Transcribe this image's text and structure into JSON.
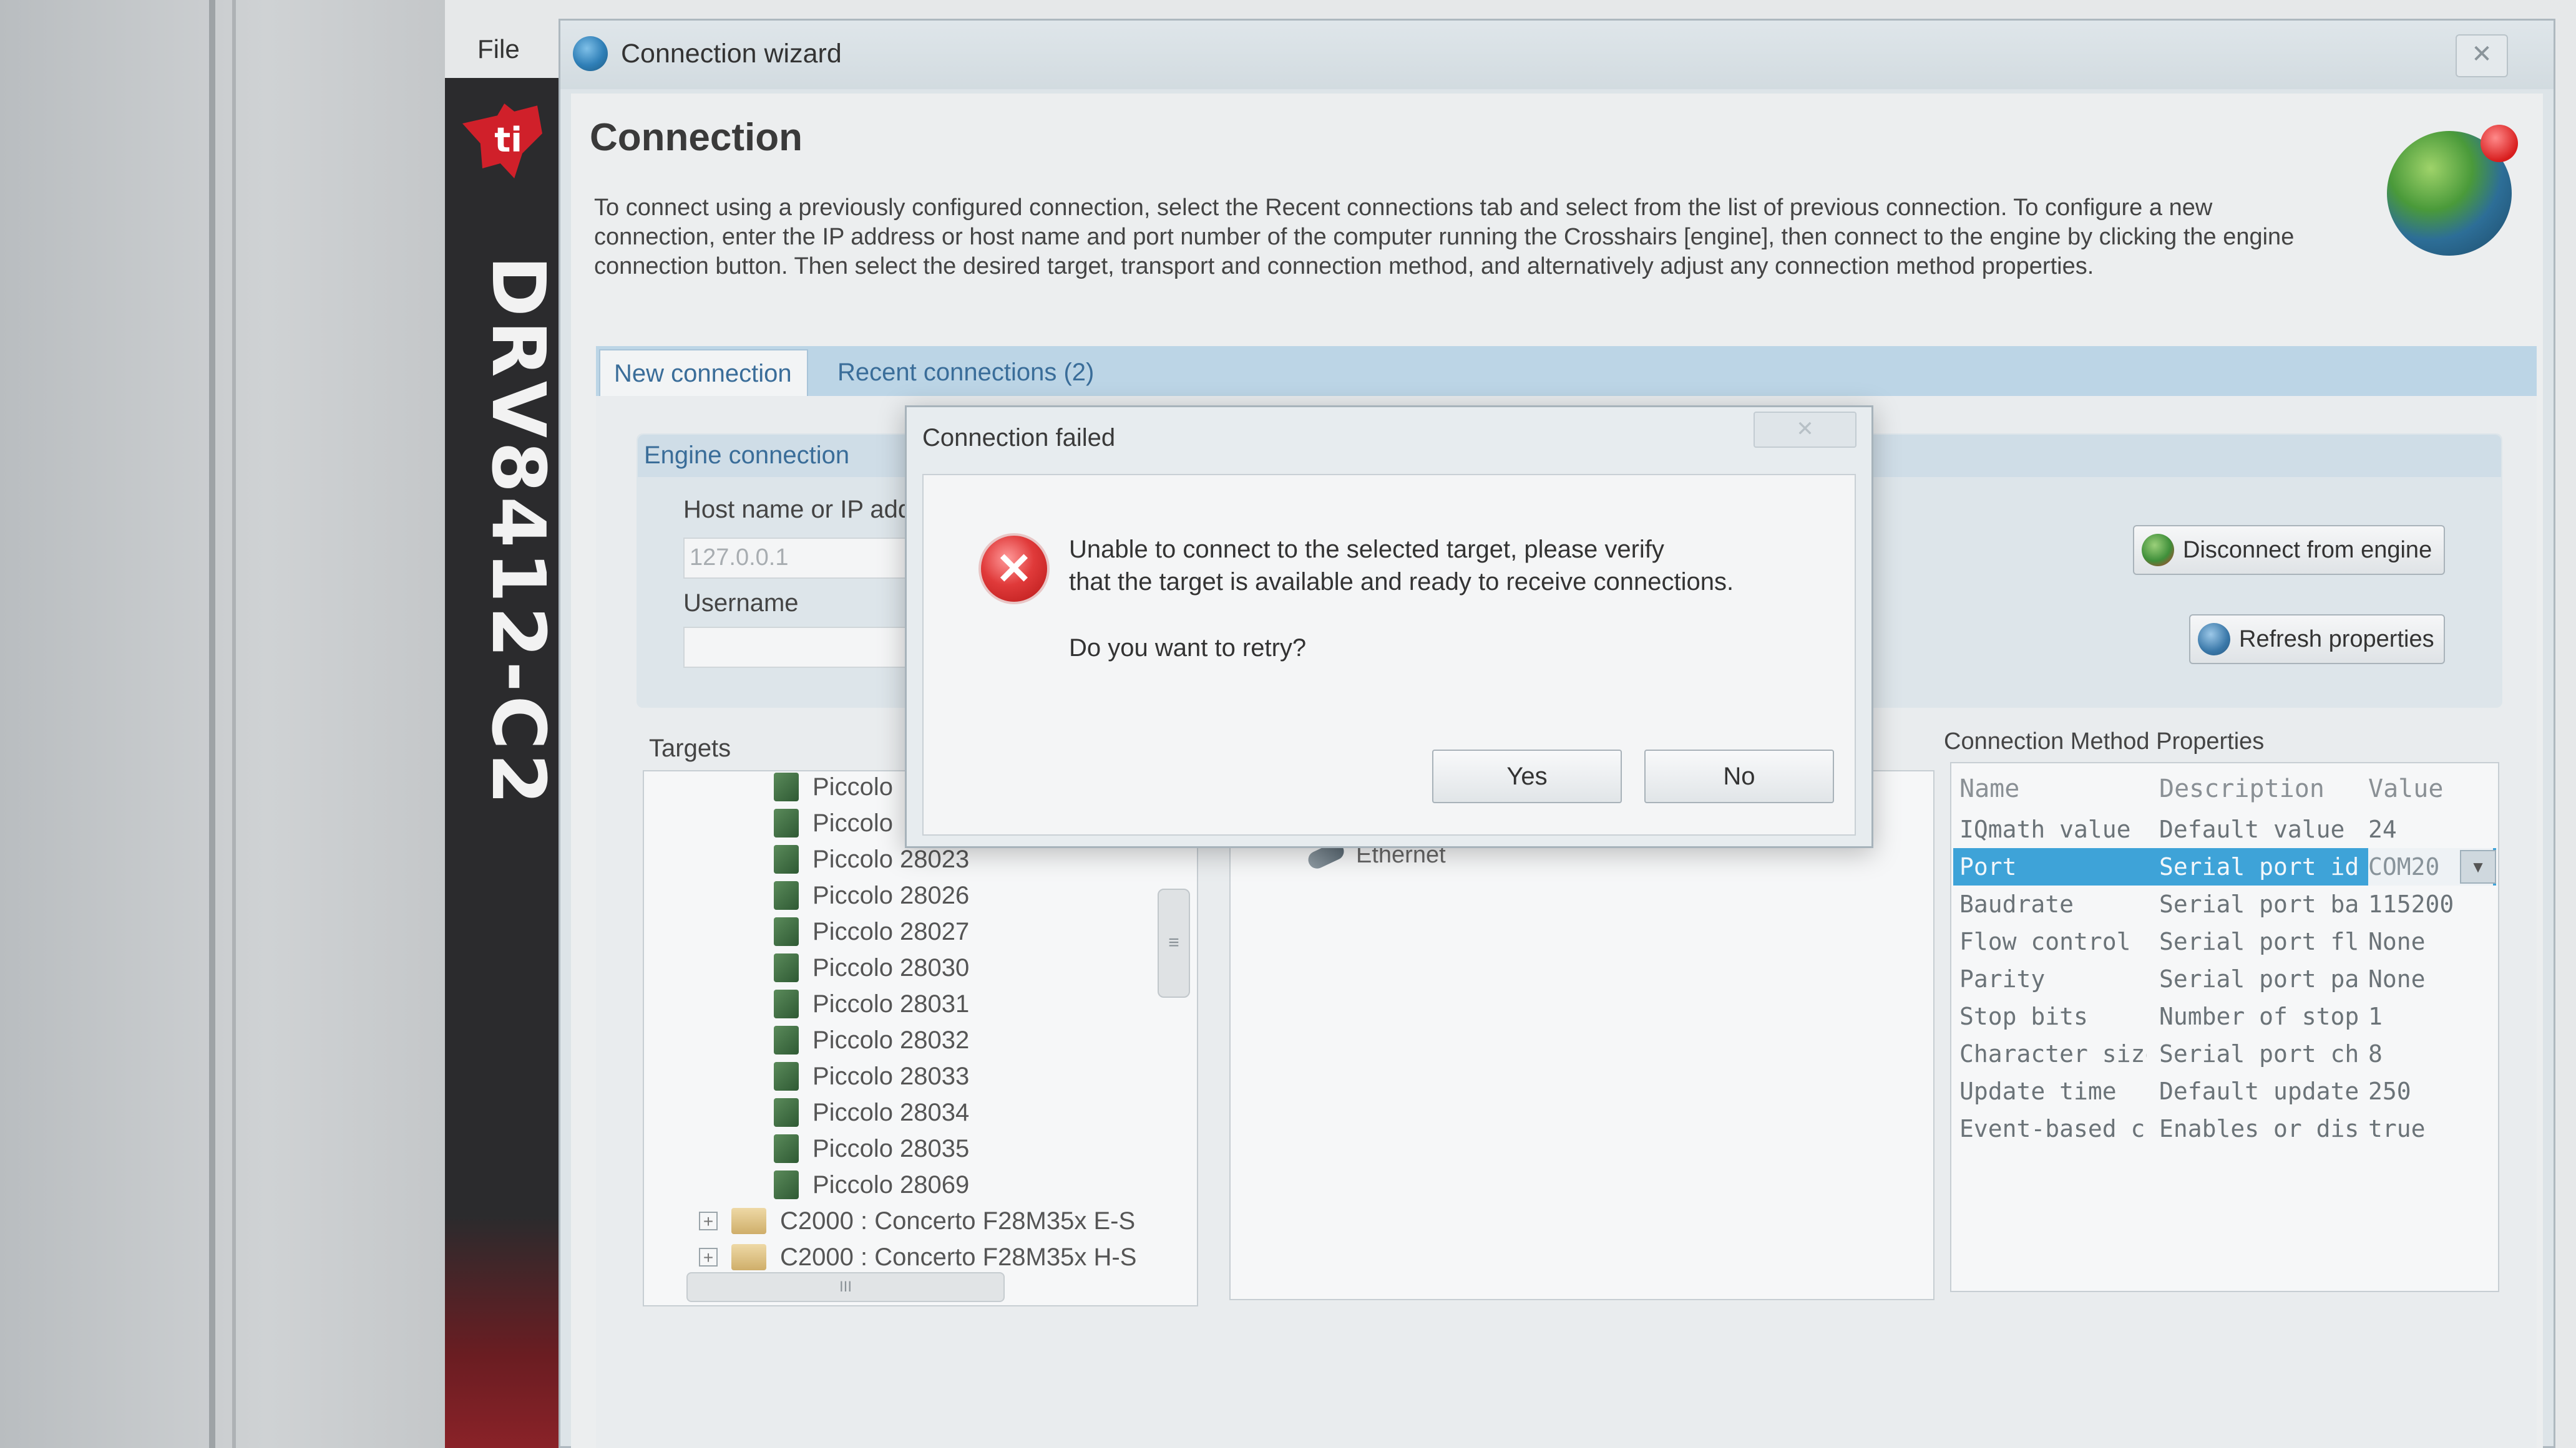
{
  "menu": {
    "file": "File"
  },
  "banner": {
    "product": "DRV8412-C2"
  },
  "wizard": {
    "title": "Connection wizard",
    "heading": "Connection",
    "description": "To connect using a previously configured connection, select the Recent connections tab and select from the list of previous connection. To configure a new connection, enter the IP address or host name and port number of the computer running the Crosshairs [engine], then connect to the engine by clicking the engine connection button. Then select the desired target, transport and connection method, and alternatively adjust any connection method properties.",
    "tabs": [
      {
        "label": "New connection",
        "active": true
      },
      {
        "label": "Recent connections (2)",
        "active": false
      }
    ]
  },
  "engine": {
    "title": "Engine connection",
    "host_label": "Host name or IP add",
    "host_value": "127.0.0.1",
    "username_label": "Username",
    "disconnect_button": "Disconnect from engine",
    "refresh_button": "Refresh properties"
  },
  "targets": {
    "label": "Targets",
    "items": [
      "Piccolo",
      "Piccolo",
      "Piccolo 28023",
      "Piccolo 28026",
      "Piccolo 28027",
      "Piccolo 28030",
      "Piccolo 28031",
      "Piccolo 28032",
      "Piccolo 28033",
      "Piccolo 28034",
      "Piccolo 28035",
      "Piccolo 28069"
    ],
    "folders": [
      "C2000 : Concerto F28M35x E-S",
      "C2000 : Concerto F28M35x H-S"
    ],
    "scroll_marker": "≡",
    "hscroll_marker": "III"
  },
  "transport": {
    "ethernet_label": "Ethernet"
  },
  "properties": {
    "label": "Connection Method Properties",
    "columns": [
      "Name",
      "Description",
      "Value"
    ],
    "rows": [
      [
        "IQmath value",
        "Default value f",
        "24"
      ],
      [
        "Port",
        "Serial port iden",
        "COM20"
      ],
      [
        "Baudrate",
        "Serial port bau",
        "115200"
      ],
      [
        "Flow control",
        "Serial port flow",
        "None"
      ],
      [
        "Parity",
        "Serial port pari",
        "None"
      ],
      [
        "Stop bits",
        "Number of stop",
        "1"
      ],
      [
        "Character size",
        "Serial port char",
        "8"
      ],
      [
        "Update time",
        "Default update",
        "250"
      ],
      [
        "Event-based c",
        "Enables or disa",
        "true"
      ]
    ],
    "selected_index": 1
  },
  "dialog": {
    "title": "Connection failed",
    "message_line1": "Unable to connect to the selected target, please verify",
    "message_line2": "that the target is available and ready to receive connections.",
    "question": "Do you want to retry?",
    "yes": "Yes",
    "no": "No",
    "close_glyph": "✕"
  },
  "colors": {
    "accent_blue": "#3ea3d8",
    "tab_text": "#3a6d99",
    "error_red": "#e03a3a",
    "banner_dark": "#2b2b2d"
  }
}
